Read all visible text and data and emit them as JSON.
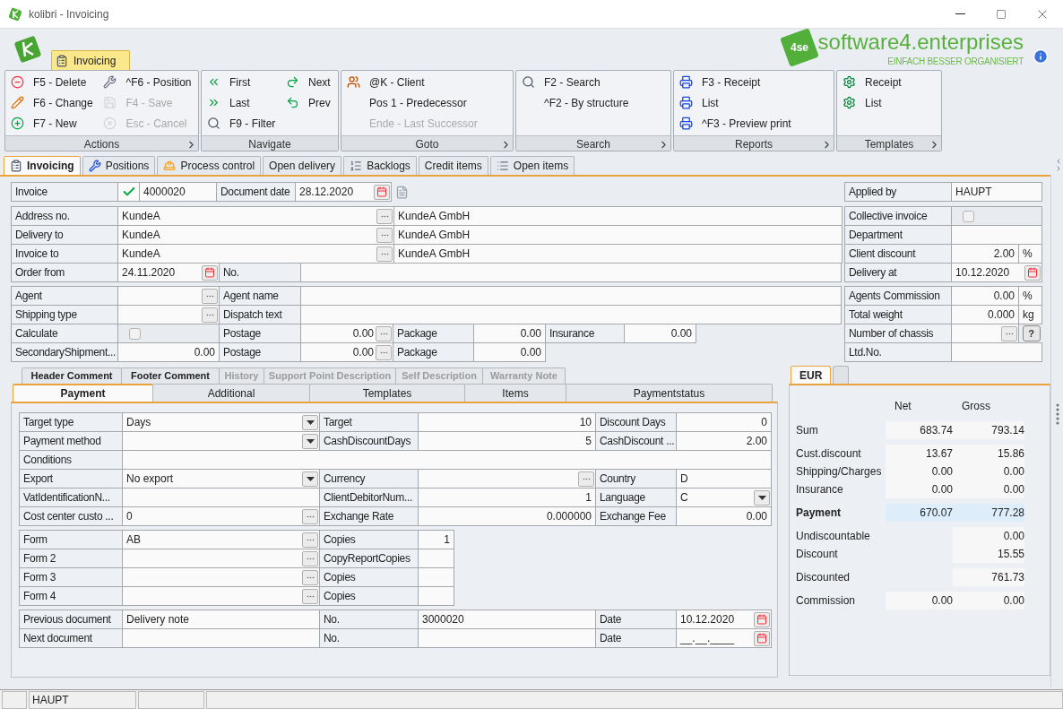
{
  "window": {
    "title": "kolibri - Invoicing"
  },
  "ribbon": {
    "tabs": [
      {
        "label": "Invoicing",
        "selected": true
      }
    ],
    "groups": [
      {
        "title": "Actions",
        "expandable": true,
        "columns": [
          [
            {
              "label": "F5 - Delete",
              "disabled": false
            },
            {
              "label": "F6 - Change",
              "disabled": false
            },
            {
              "label": "F7 - New",
              "disabled": false
            }
          ],
          [
            {
              "label": "^F6 - Position",
              "disabled": false
            },
            {
              "label": "F4 - Save",
              "disabled": true
            },
            {
              "label": "Esc - Cancel",
              "disabled": true
            }
          ]
        ]
      },
      {
        "title": "Navigate",
        "expandable": false,
        "columns": [
          [
            {
              "label": "First",
              "disabled": false
            },
            {
              "label": "Last",
              "disabled": false
            },
            {
              "label": "F9 - Filter",
              "disabled": false
            }
          ],
          [
            {
              "label": "Next",
              "disabled": false
            },
            {
              "label": "Prev",
              "disabled": false
            }
          ]
        ]
      },
      {
        "title": "Goto",
        "expandable": true,
        "columns": [
          [
            {
              "label": "@K - Client",
              "disabled": false
            },
            {
              "label": "Pos 1 - Predecessor",
              "disabled": false
            },
            {
              "label": "Ende - Last Successor",
              "disabled": true
            }
          ]
        ]
      },
      {
        "title": "Search",
        "expandable": true,
        "columns": [
          [
            {
              "label": "F2 - Search",
              "disabled": false
            },
            {
              "label": "^F2 - By structure",
              "disabled": false
            }
          ]
        ]
      },
      {
        "title": "Reports",
        "expandable": true,
        "columns": [
          [
            {
              "label": "F3 - Receipt",
              "disabled": false
            },
            {
              "label": "List",
              "disabled": false
            },
            {
              "label": "^F3 - Preview print",
              "disabled": false
            }
          ]
        ]
      },
      {
        "title": "Templates",
        "expandable": true,
        "columns": [
          [
            {
              "label": "Receipt",
              "disabled": false
            },
            {
              "label": "List",
              "disabled": false
            }
          ]
        ]
      }
    ]
  },
  "brand": {
    "logo_text": "4se",
    "name": "software4.enterprises",
    "tagline": "EINFACH BESSER ORGANISIERT"
  },
  "main_tabs": [
    {
      "label": "Invoicing",
      "selected": true
    },
    {
      "label": "Positions",
      "selected": false
    },
    {
      "label": "Process control",
      "selected": false
    },
    {
      "label": "Open delivery",
      "selected": false
    },
    {
      "label": "Backlogs",
      "selected": false
    },
    {
      "label": "Credit items",
      "selected": false
    },
    {
      "label": "Open items",
      "selected": false
    }
  ],
  "header_rows": [
    {
      "left": [
        {
          "kind": "label",
          "text": "Invoice"
        },
        {
          "kind": "status"
        },
        {
          "kind": "text",
          "text": "4000020"
        },
        {
          "kind": "label",
          "text": "Document date"
        },
        {
          "kind": "date",
          "text": "28.12.2020"
        },
        {
          "kind": "edit"
        }
      ],
      "right": [
        {
          "kind": "label",
          "text": "Applied by"
        },
        {
          "kind": "text",
          "text": "HAUPT"
        }
      ]
    },
    {
      "left": [
        {
          "kind": "label",
          "text": "Address no."
        },
        {
          "kind": "lookup",
          "text": "KundeA"
        },
        {
          "kind": "text",
          "text": "KundeA GmbH"
        }
      ],
      "right": [
        {
          "kind": "label",
          "text": "Collective invoice"
        },
        {
          "kind": "checkbox",
          "checked": false
        }
      ]
    },
    {
      "left": [
        {
          "kind": "label",
          "text": "Delivery to"
        },
        {
          "kind": "lookup",
          "text": "KundeA"
        },
        {
          "kind": "text",
          "text": "KundeA GmbH"
        }
      ],
      "right": [
        {
          "kind": "label",
          "text": "Department"
        },
        {
          "kind": "text"
        }
      ]
    },
    {
      "left": [
        {
          "kind": "label",
          "text": "Invoice to"
        },
        {
          "kind": "lookup",
          "text": "KundeA"
        },
        {
          "kind": "text",
          "text": "KundeA GmbH"
        }
      ],
      "right": [
        {
          "kind": "label",
          "text": "Client discount"
        },
        {
          "kind": "number",
          "text": "2.00"
        },
        {
          "kind": "unit",
          "text": "%"
        }
      ]
    },
    {
      "left": [
        {
          "kind": "label",
          "text": "Order from"
        },
        {
          "kind": "date",
          "text": "24.11.2020"
        },
        {
          "kind": "label",
          "text": "No."
        },
        {
          "kind": "text"
        }
      ],
      "right": [
        {
          "kind": "label",
          "text": "Delivery at"
        },
        {
          "kind": "date",
          "text": "10.12.2020"
        }
      ]
    },
    {
      "left": [
        {
          "kind": "label",
          "text": "Agent"
        },
        {
          "kind": "lookup"
        },
        {
          "kind": "label",
          "text": "Agent name"
        },
        {
          "kind": "text"
        }
      ],
      "right": [
        {
          "kind": "label",
          "text": "Agents Commission"
        },
        {
          "kind": "number",
          "text": "0.00"
        },
        {
          "kind": "unit",
          "text": "%"
        }
      ]
    },
    {
      "left": [
        {
          "kind": "label",
          "text": "Shipping type"
        },
        {
          "kind": "lookup"
        },
        {
          "kind": "label",
          "text": "Dispatch text"
        },
        {
          "kind": "text"
        }
      ],
      "right": [
        {
          "kind": "label",
          "text": "Total weight"
        },
        {
          "kind": "number",
          "text": "0.000"
        },
        {
          "kind": "unit",
          "text": "kg"
        }
      ]
    },
    {
      "left": [
        {
          "kind": "label",
          "text": "Calculate"
        },
        {
          "kind": "checkbox",
          "checked": false
        },
        {
          "kind": "label",
          "text": "Postage"
        },
        {
          "kind": "number-lookup",
          "text": "0.00"
        },
        {
          "kind": "label",
          "text": "Package"
        },
        {
          "kind": "number",
          "text": "0.00"
        },
        {
          "kind": "label",
          "text": "Insurance"
        },
        {
          "kind": "number",
          "text": "0.00"
        }
      ],
      "right": [
        {
          "kind": "label",
          "text": "Number of chassis"
        },
        {
          "kind": "lookup"
        },
        {
          "kind": "help",
          "text": "?"
        }
      ]
    },
    {
      "left": [
        {
          "kind": "label",
          "text": "SecondaryShipment..."
        },
        {
          "kind": "number",
          "text": "0.00"
        },
        {
          "kind": "label",
          "text": "Postage"
        },
        {
          "kind": "number-lookup",
          "text": "0.00"
        },
        {
          "kind": "label",
          "text": "Package"
        },
        {
          "kind": "number",
          "text": "0.00"
        }
      ],
      "right": [
        {
          "kind": "label",
          "text": "Ltd.No."
        },
        {
          "kind": "text"
        }
      ]
    }
  ],
  "detail_tab_rows": [
    {
      "tabs": [
        {
          "label": "Header Comment",
          "selected": false,
          "disabled": false
        },
        {
          "label": "Footer Comment",
          "selected": false,
          "disabled": false
        },
        {
          "label": "History",
          "selected": false,
          "disabled": true
        },
        {
          "label": "Support Point Description",
          "selected": false,
          "disabled": true
        },
        {
          "label": "Self Description",
          "selected": false,
          "disabled": true
        },
        {
          "label": "Warranty Note",
          "selected": false,
          "disabled": true
        }
      ]
    },
    {
      "tabs": [
        {
          "label": "Payment",
          "selected": true,
          "disabled": false
        },
        {
          "label": "Additional",
          "selected": false,
          "disabled": false
        },
        {
          "label": "Templates",
          "selected": false,
          "disabled": false
        },
        {
          "label": "Items",
          "selected": false,
          "disabled": false
        },
        {
          "label": "Paymentstatus",
          "selected": false,
          "disabled": false
        }
      ]
    }
  ],
  "payment_rows": [
    [
      {
        "kind": "label",
        "text": "Target type"
      },
      {
        "kind": "dropdown",
        "text": "Days"
      },
      {
        "kind": "label",
        "text": "Target"
      },
      {
        "kind": "number",
        "text": "10"
      },
      {
        "kind": "label",
        "text": "Discount Days"
      },
      {
        "kind": "number",
        "text": "0"
      }
    ],
    [
      {
        "kind": "label",
        "text": "Payment method"
      },
      {
        "kind": "dropdown"
      },
      {
        "kind": "label",
        "text": "CashDiscountDays"
      },
      {
        "kind": "number",
        "text": "5"
      },
      {
        "kind": "label",
        "text": "CashDiscount ..."
      },
      {
        "kind": "number",
        "text": "2.00"
      }
    ],
    [
      {
        "kind": "label",
        "text": "Conditions"
      },
      {
        "kind": "text"
      }
    ],
    [
      {
        "kind": "label",
        "text": "Export"
      },
      {
        "kind": "dropdown",
        "text": "No export"
      },
      {
        "kind": "label",
        "text": "Currency"
      },
      {
        "kind": "lookup"
      },
      {
        "kind": "label",
        "text": "Country"
      },
      {
        "kind": "text",
        "text": "D"
      }
    ],
    [
      {
        "kind": "label",
        "text": "VatIdentificationN..."
      },
      {
        "kind": "text"
      },
      {
        "kind": "label",
        "text": "ClientDebitorNum..."
      },
      {
        "kind": "number",
        "text": "1"
      },
      {
        "kind": "label",
        "text": "Language"
      },
      {
        "kind": "dropdown",
        "text": "C"
      }
    ],
    [
      {
        "kind": "label",
        "text": "Cost center custo ..."
      },
      {
        "kind": "lookup",
        "text": "0"
      },
      {
        "kind": "label",
        "text": "Exchange Rate"
      },
      {
        "kind": "number",
        "text": "0.000000"
      },
      {
        "kind": "label",
        "text": "Exchange Fee"
      },
      {
        "kind": "number",
        "text": "0.00"
      }
    ],
    [
      {
        "kind": "label",
        "text": "Form"
      },
      {
        "kind": "lookup",
        "text": "AB"
      },
      {
        "kind": "label",
        "text": "Copies"
      },
      {
        "kind": "number",
        "text": "1"
      }
    ],
    [
      {
        "kind": "label",
        "text": "Form 2"
      },
      {
        "kind": "lookup"
      },
      {
        "kind": "label",
        "text": "CopyReportCopies"
      },
      {
        "kind": "number"
      }
    ],
    [
      {
        "kind": "label",
        "text": "Form 3"
      },
      {
        "kind": "lookup"
      },
      {
        "kind": "label",
        "text": "Copies"
      },
      {
        "kind": "number"
      }
    ],
    [
      {
        "kind": "label",
        "text": "Form 4"
      },
      {
        "kind": "lookup"
      },
      {
        "kind": "label",
        "text": "Copies"
      },
      {
        "kind": "number"
      }
    ],
    [
      {
        "kind": "label",
        "text": "Previous document"
      },
      {
        "kind": "text",
        "text": "Delivery note"
      },
      {
        "kind": "label",
        "text": "No."
      },
      {
        "kind": "text",
        "text": "3000020"
      },
      {
        "kind": "label",
        "text": "Date"
      },
      {
        "kind": "date",
        "text": "10.12.2020"
      }
    ],
    [
      {
        "kind": "label",
        "text": "Next document"
      },
      {
        "kind": "text"
      },
      {
        "kind": "label",
        "text": "No."
      },
      {
        "kind": "text"
      },
      {
        "kind": "label",
        "text": "Date"
      },
      {
        "kind": "date",
        "text": "__.__.____"
      }
    ]
  ],
  "totals": {
    "tabs": [
      {
        "label": "EUR",
        "selected": true
      },
      {
        "selected": false
      }
    ],
    "columns": [
      "Net",
      "Gross"
    ],
    "groups": [
      [
        {
          "label": "Sum",
          "net": "683.74",
          "gross": "793.14",
          "highlighted": false
        }
      ],
      [
        {
          "label": "Cust.discount",
          "net": "13.67",
          "gross": "15.86",
          "highlighted": false
        },
        {
          "label": "Shipping/Charges",
          "net": "0.00",
          "gross": "0.00",
          "highlighted": false
        },
        {
          "label": "Insurance",
          "net": "0.00",
          "gross": "0.00",
          "highlighted": false
        }
      ],
      [
        {
          "label": "Payment",
          "net": "670.07",
          "gross": "777.28",
          "highlighted": true
        }
      ],
      [
        {
          "label": "Undiscountable",
          "gross": "0.00",
          "highlighted": false
        },
        {
          "label": "Discount",
          "gross": "15.55",
          "highlighted": false
        }
      ],
      [
        {
          "label": "Discounted",
          "gross": "761.73",
          "highlighted": false
        }
      ],
      [
        {
          "label": "Commission",
          "net": "0.00",
          "gross": "0.00",
          "highlighted": false
        }
      ]
    ]
  },
  "status_bar": {
    "user": "HAUPT"
  }
}
